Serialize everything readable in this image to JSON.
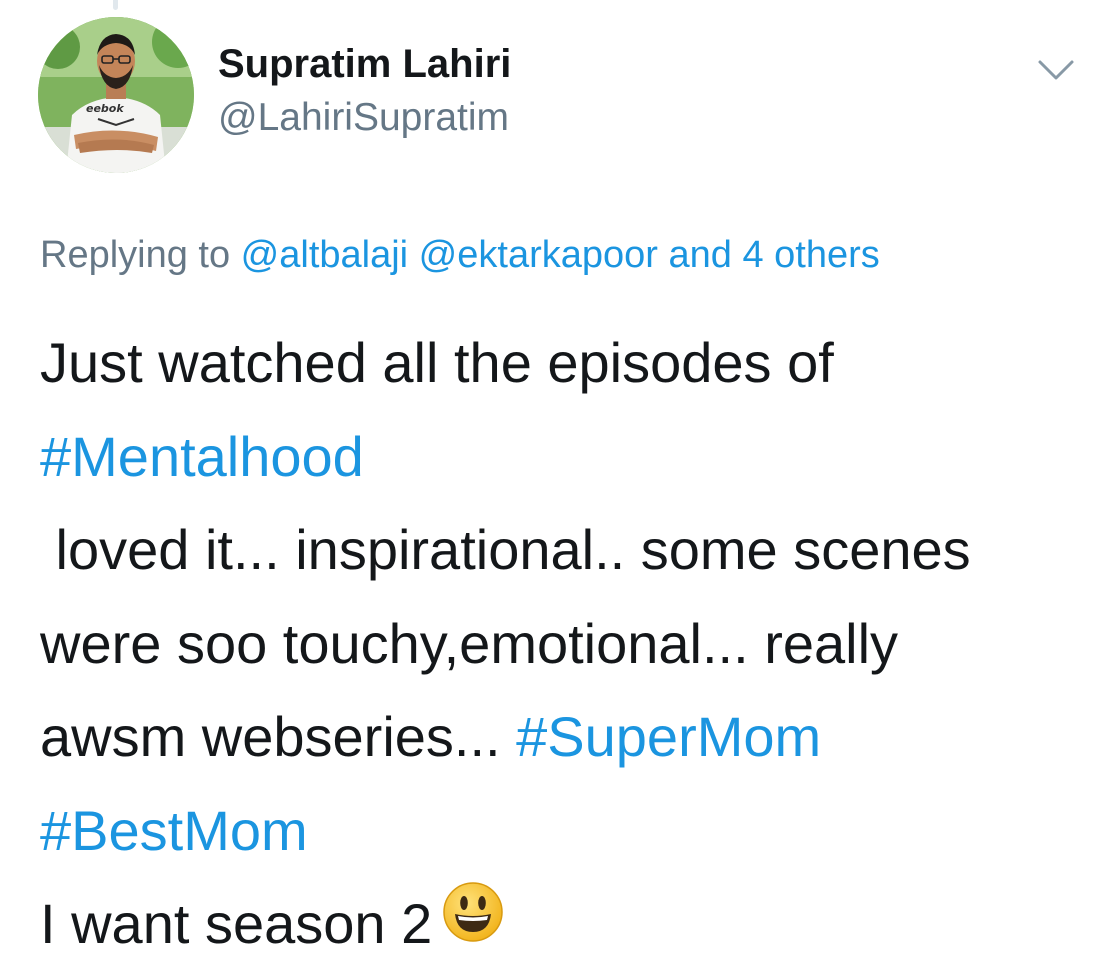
{
  "author": {
    "display_name": "Supratim Lahiri",
    "handle": "@LahiriSupratim",
    "avatar_shirt_text": "eebok"
  },
  "menu": {
    "icon": "chevron-down-icon"
  },
  "reply": {
    "prefix": "Replying to ",
    "mention_1": "@altbalaji",
    "mention_2": "@ektarkapoor",
    "others": "and 4 others"
  },
  "tweet": {
    "line1": "Just watched all the episodes of",
    "hashtag_mentalhood": "#Mentalhood",
    "line3": " loved it... inspirational.. some scenes",
    "line4": "were soo touchy,emotional... really",
    "line5_text": "awsm webseries... ",
    "hashtag_supermom": "#SuperMom",
    "hashtag_bestmom": "#BestMom",
    "line7": "I want season 2",
    "emoji": "smiley-emoji"
  },
  "colors": {
    "link": "#1b95e0",
    "secondary_text": "#657786",
    "primary_text": "#14171a",
    "emoji_yellow": "#f7c531"
  }
}
